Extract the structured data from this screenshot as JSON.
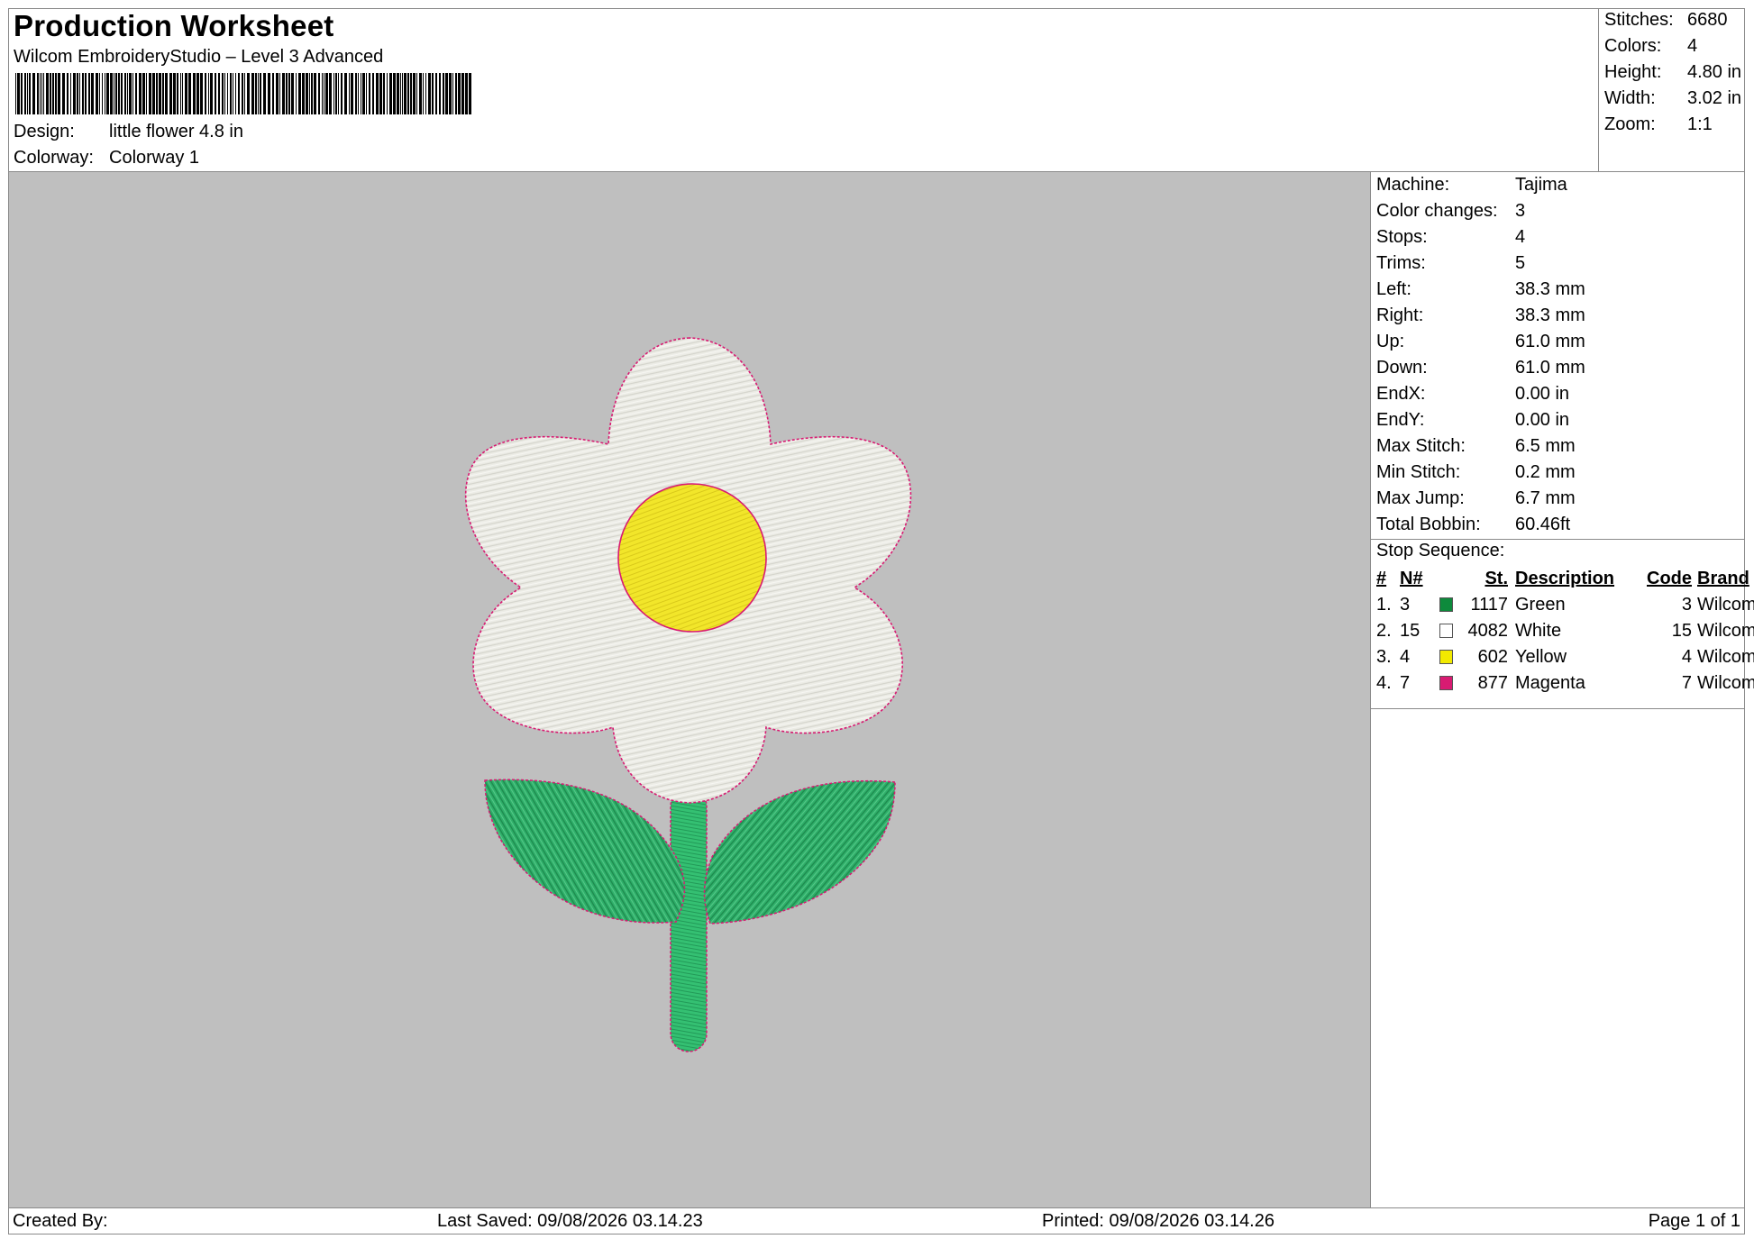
{
  "header": {
    "title": "Production Worksheet",
    "software": "Wilcom EmbroideryStudio – Level 3 Advanced",
    "design_label": "Design:",
    "design_value": "little flower 4.8 in",
    "colorway_label": "Colorway:",
    "colorway_value": "Colorway 1"
  },
  "summary": [
    {
      "label": "Stitches:",
      "value": "6680"
    },
    {
      "label": "Colors:",
      "value": "4"
    },
    {
      "label": "Height:",
      "value": "4.80 in"
    },
    {
      "label": "Width:",
      "value": "3.02 in"
    },
    {
      "label": "Zoom:",
      "value": "1:1"
    }
  ],
  "machine_info": [
    {
      "label": "Machine:",
      "value": "Tajima"
    },
    {
      "label": "Color changes:",
      "value": "3"
    },
    {
      "label": "Stops:",
      "value": "4"
    },
    {
      "label": "Trims:",
      "value": "5"
    },
    {
      "label": "Left:",
      "value": "38.3 mm"
    },
    {
      "label": "Right:",
      "value": "38.3 mm"
    },
    {
      "label": "Up:",
      "value": "61.0 mm"
    },
    {
      "label": "Down:",
      "value": "61.0 mm"
    },
    {
      "label": "EndX:",
      "value": "0.00 in"
    },
    {
      "label": "EndY:",
      "value": "0.00 in"
    },
    {
      "label": "Max Stitch:",
      "value": "6.5 mm"
    },
    {
      "label": "Min Stitch:",
      "value": "0.2 mm"
    },
    {
      "label": "Max Jump:",
      "value": "6.7 mm"
    },
    {
      "label": "Total Bobbin:",
      "value": "60.46ft"
    }
  ],
  "stop_sequence": {
    "heading": "Stop Sequence:",
    "columns": {
      "num": "#",
      "n": "N#",
      "st": "St.",
      "description": "Description",
      "code": "Code",
      "brand": "Brand"
    },
    "rows": [
      {
        "num": "1.",
        "n": "3",
        "color": "#0e8a3c",
        "st": "1117",
        "description": "Green",
        "code": "3",
        "brand": "Wilcom"
      },
      {
        "num": "2.",
        "n": "15",
        "color": "#ffffff",
        "st": "4082",
        "description": "White",
        "code": "15",
        "brand": "Wilcom"
      },
      {
        "num": "3.",
        "n": "4",
        "color": "#f2ea00",
        "st": "602",
        "description": "Yellow",
        "code": "4",
        "brand": "Wilcom"
      },
      {
        "num": "4.",
        "n": "7",
        "color": "#d81b72",
        "st": "877",
        "description": "Magenta",
        "code": "7",
        "brand": "Wilcom"
      }
    ]
  },
  "footer": {
    "created_by": "Created By:",
    "last_saved": "Last Saved: 09/08/2026 03.14.23",
    "printed": "Printed: 09/08/2026 03.14.26",
    "page": "Page 1 of 1"
  },
  "colors": {
    "canvas_bg": "#bfbfbf",
    "petal": "#ecece6",
    "center": "#f2e62a",
    "leaf": "#2fb06a",
    "stem": "#34c072",
    "outline": "#d81b72",
    "border": "#8a8a8a"
  },
  "icons": {
    "barcode": "barcode-icon",
    "design_preview": "flower-embroidery-preview"
  }
}
